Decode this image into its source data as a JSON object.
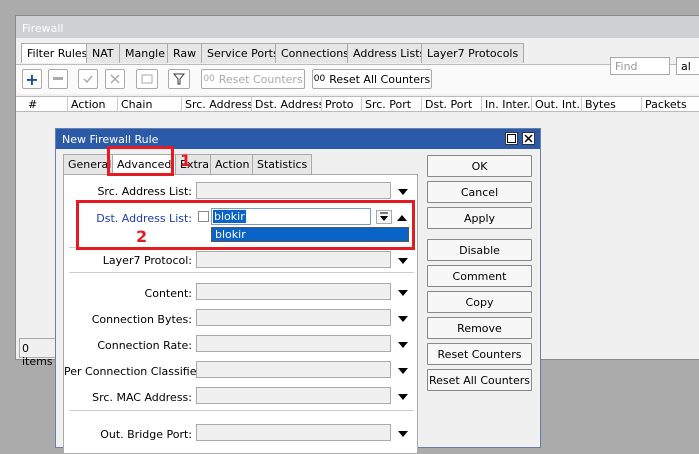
{
  "window": {
    "title": "Firewall",
    "tabs": [
      "Filter Rules",
      "NAT",
      "Mangle",
      "Raw",
      "Service Ports",
      "Connections",
      "Address Lists",
      "Layer7 Protocols"
    ],
    "toolbar": {
      "add": "+",
      "reset_counters": "Reset Counters",
      "reset_all_counters": "Reset All Counters",
      "find_placeholder": "Find",
      "find2_value": "al"
    },
    "columns": [
      "#",
      "Action",
      "Chain",
      "Src. Address",
      "Dst. Address",
      "Proto",
      "Src. Port",
      "Dst. Port",
      "In. Inter...",
      "Out. Int...",
      "Bytes",
      "Packets"
    ],
    "status": "0 items"
  },
  "dialog": {
    "title": "New Firewall Rule",
    "tabs": [
      "General",
      "Advanced",
      "Extra",
      "Action",
      "Statistics"
    ],
    "fields": {
      "src_address_list": "Src. Address List:",
      "dst_address_list": "Dst. Address List:",
      "dst_address_list_value": "blokir",
      "dropdown_option": "blokir",
      "layer7": "Layer7 Protocol:",
      "content": "Content:",
      "connection_bytes": "Connection Bytes:",
      "connection_rate": "Connection Rate:",
      "per_connection_classifier": "Per Connection Classifier:",
      "src_mac": "Src. MAC Address:",
      "out_bridge_port": "Out. Bridge Port:"
    },
    "buttons": [
      "OK",
      "Cancel",
      "Apply",
      "Disable",
      "Comment",
      "Copy",
      "Remove",
      "Reset Counters",
      "Reset All Counters"
    ]
  },
  "annotations": {
    "one": "1",
    "two": "2"
  },
  "colors": {
    "dialog_title_bg": "#2b5aa8",
    "highlight": "#e51b23",
    "selected_bg": "#0a64c8"
  }
}
